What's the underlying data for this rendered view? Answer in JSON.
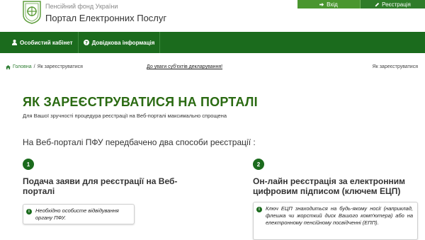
{
  "header": {
    "org_name": "Пенсійний фонд України",
    "portal_name": "Портал Електронних Послуг",
    "login_label": "Вхід",
    "register_label": "Реєстрація"
  },
  "nav": {
    "items": [
      {
        "label": "Особистий кабінет",
        "icon": "user-icon"
      },
      {
        "label": "Довідкова інформація",
        "icon": "question-circle-icon"
      }
    ]
  },
  "breadcrumb": {
    "home": "Головна",
    "separator": "/",
    "current": "Як зареєструватися",
    "center_link": "До уваги суб'єктів декларування!",
    "right_label": "Як зареєструватися"
  },
  "main": {
    "title": "ЯК ЗАРЕЄСТРУВАТИСЯ НА ПОРТАЛІ",
    "subtitle": "Для Вашої зручності процедура реєстрації на Веб-порталі максимально спрощена",
    "lead": "На Веб-порталі ПФУ передбачено два способи реєстрації :",
    "methods": [
      {
        "number": "1",
        "title": "Подача заяви для реєстрації на Веб-порталі",
        "note": "Необхідно особисте відвідування органу ПФУ."
      },
      {
        "number": "2",
        "title": "Он-лайн реєстрація за електронним цифровим підписом (ключем ЕЦП)",
        "note": "Ключ ЕЦП знаходиться на будь-якому носії (наприклад, флешка чи жорсткий диск Вашого комп'ютера) або на електронному пенсійному посвідченні (ЕПП)."
      }
    ]
  },
  "colors": {
    "brand_green": "#1b6b1d",
    "title_green": "#2a6a12",
    "button_green": "#4a962f"
  }
}
